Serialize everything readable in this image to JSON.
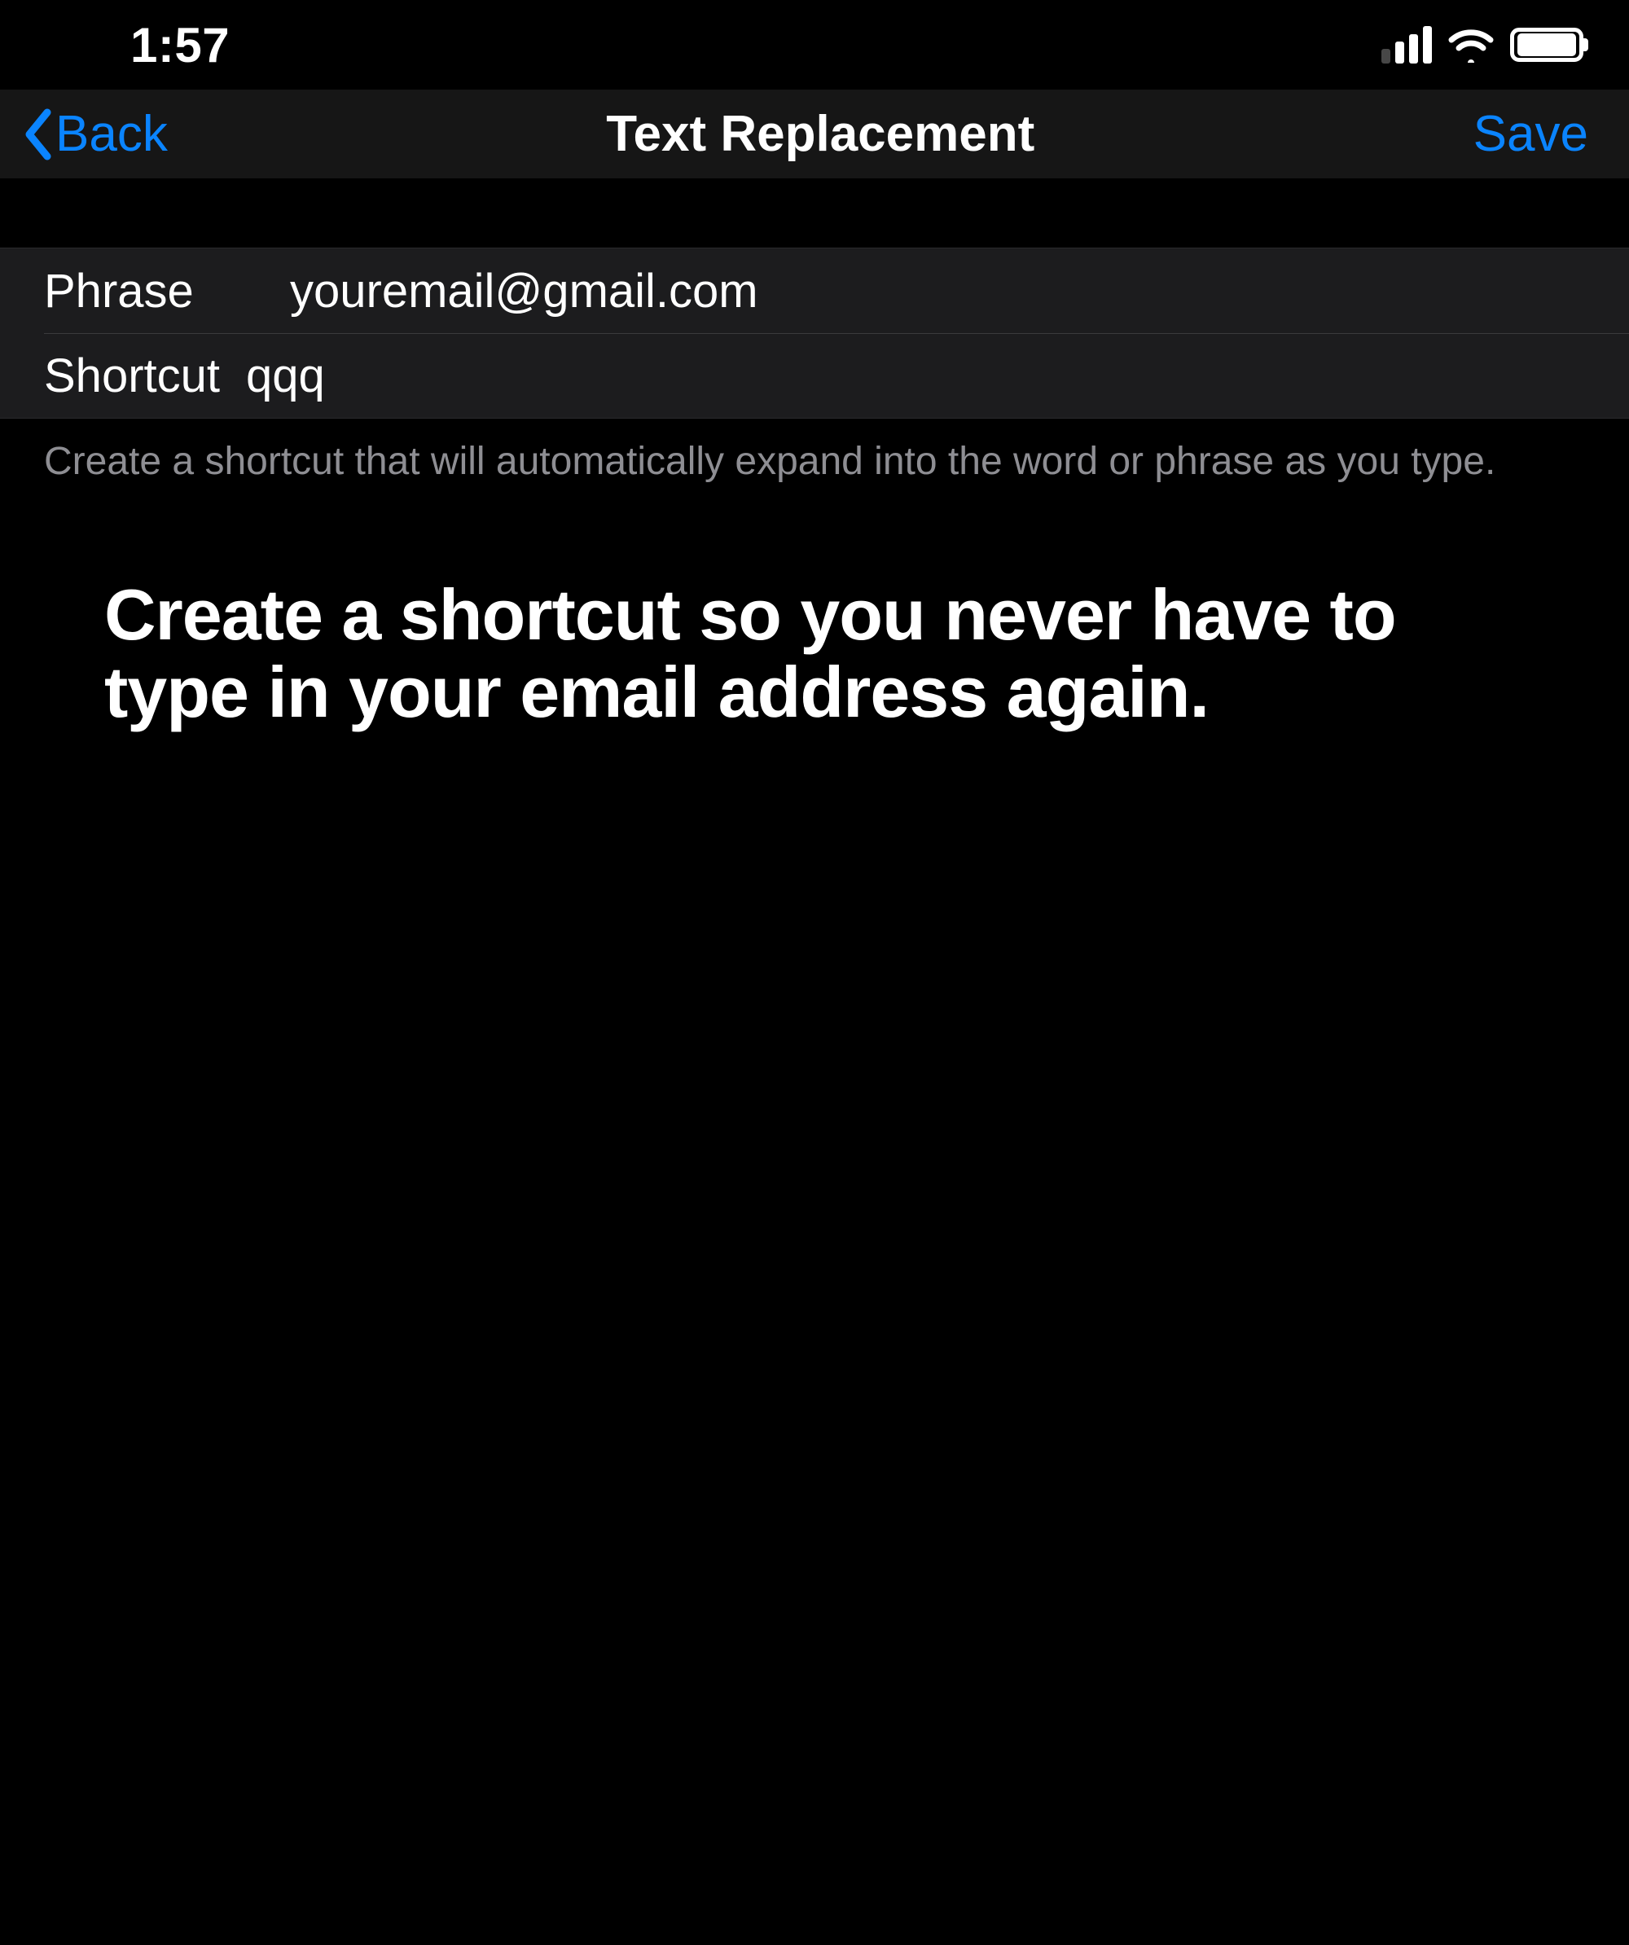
{
  "status": {
    "time": "1:57"
  },
  "nav": {
    "back_label": "Back",
    "title": "Text Replacement",
    "save_label": "Save"
  },
  "form": {
    "phrase_label": "Phrase",
    "phrase_value": "youremail@gmail.com",
    "shortcut_label": "Shortcut",
    "shortcut_value": "qqq"
  },
  "footer": "Create a shortcut that will automatically expand into the word or phrase as you type.",
  "caption": "Create a shortcut so you never have to type in your email address again.",
  "colors": {
    "accent": "#0a84ff",
    "groupBg": "#1c1c1e",
    "divider": "#3a3a3c",
    "secondaryText": "#8e8e93"
  }
}
